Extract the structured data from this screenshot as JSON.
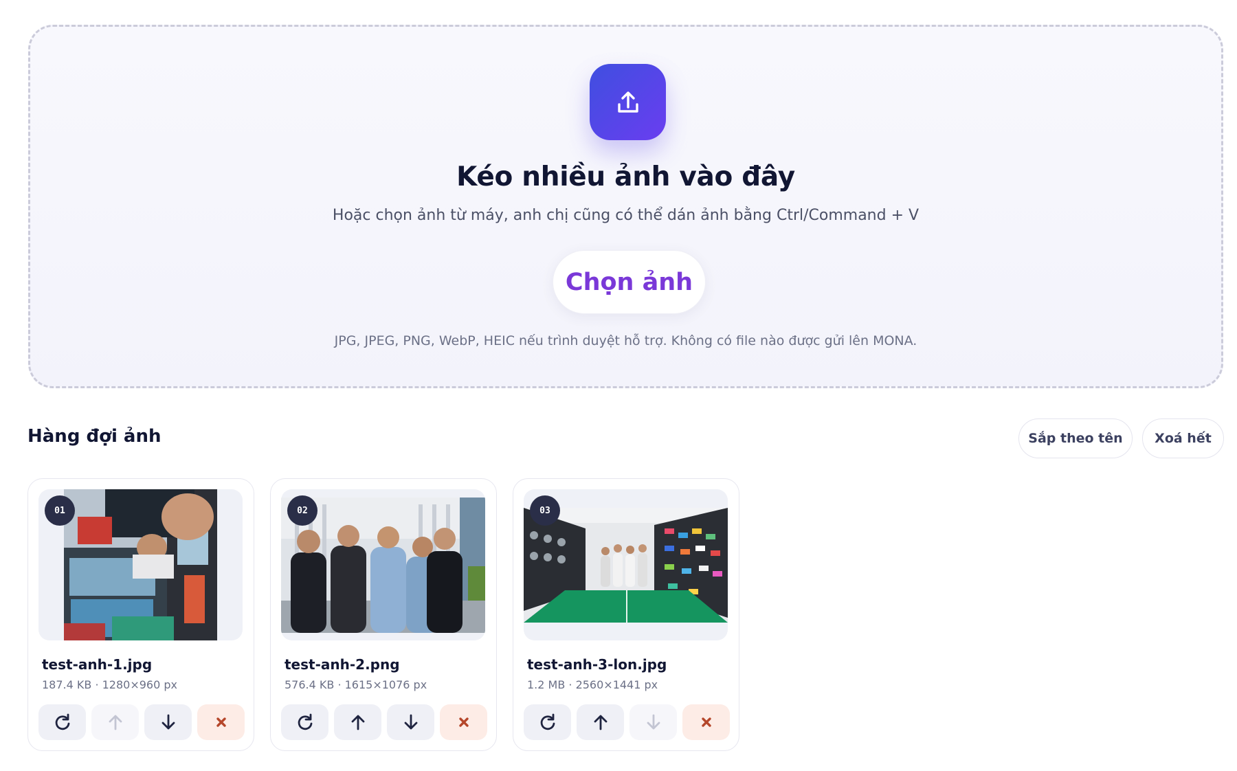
{
  "dropzone": {
    "icon": "upload-icon",
    "title": "Kéo nhiều ảnh vào đây",
    "subtitle": "Hoặc chọn ảnh từ máy, anh chị cũng có thể dán ảnh bằng Ctrl/Command + V",
    "choose_label": "Chọn ảnh",
    "note": "JPG, JPEG, PNG, WebP, HEIC nếu trình duyệt hỗ trợ. Không có file nào được gửi lên MONA.",
    "accent_gradient": [
      "#3f4fe0",
      "#6a3df0"
    ],
    "button_text_color": "#7a38d8"
  },
  "queue": {
    "title": "Hàng đợi ảnh",
    "sort_label": "Sắp theo tên",
    "clear_label": "Xoá hết",
    "items": [
      {
        "index": "01",
        "name": "test-anh-1.jpg",
        "meta": "187.4 KB · 1280×960 px",
        "move_up_enabled": false,
        "move_down_enabled": true
      },
      {
        "index": "02",
        "name": "test-anh-2.png",
        "meta": "576.4 KB · 1615×1076 px",
        "move_up_enabled": true,
        "move_down_enabled": true
      },
      {
        "index": "03",
        "name": "test-anh-3-lon.jpg",
        "meta": "1.2 MB · 2560×1441 px",
        "move_up_enabled": true,
        "move_down_enabled": false
      }
    ],
    "action_icons": [
      "rotate-icon",
      "arrow-up-icon",
      "arrow-down-icon",
      "remove-icon"
    ],
    "remove_color": "#b5462a"
  }
}
